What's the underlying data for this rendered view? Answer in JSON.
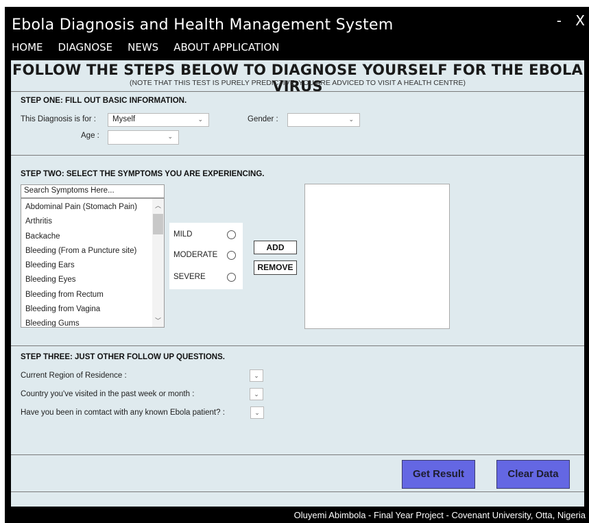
{
  "window": {
    "title": "Ebola Diagnosis and Health Management System",
    "minimize": "-",
    "close": "X"
  },
  "menu": [
    "HOME",
    "DIAGNOSE",
    "NEWS",
    "ABOUT APPLICATION"
  ],
  "main": {
    "heading": "FOLLOW THE STEPS BELOW TO DIAGNOSE YOURSELF FOR THE EBOLA VIRUS",
    "subheading": "(NOTE THAT THIS TEST IS PURELY PREDICTIVE, YOU ARE ADVICED TO VISIT A HEALTH CENTRE)"
  },
  "step1": {
    "heading": "STEP ONE: FILL OUT BASIC INFORMATION.",
    "diagnosis_for_label": "This Diagnosis is for :",
    "diagnosis_for_value": "Myself",
    "gender_label": "Gender :",
    "gender_value": "",
    "age_label": "Age :",
    "age_value": ""
  },
  "step2": {
    "heading": "STEP TWO: SELECT THE SYMPTOMS YOU ARE EXPERIENCING.",
    "search_placeholder": "Search Symptoms Here...",
    "symptoms": [
      "Abdominal Pain (Stomach Pain)",
      "Arthritis",
      "Backache",
      "Bleeding (From a Puncture site)",
      "Bleeding Ears",
      "Bleeding Eyes",
      "Bleeding from Rectum",
      "Bleeding from Vagina",
      "Bleeding Gums"
    ],
    "severity": [
      "MILD",
      "MODERATE",
      "SEVERE"
    ],
    "add_label": "ADD",
    "remove_label": "REMOVE"
  },
  "step3": {
    "heading": "STEP THREE: JUST OTHER FOLLOW UP QUESTIONS.",
    "q_region": "Current Region of Residence :",
    "q_country": "Country you've visited in the past week or month :",
    "q_contact": "Have you been in comtact with any known Ebola patient? :"
  },
  "actions": {
    "get_result": "Get Result",
    "clear_data": "Clear Data"
  },
  "footer": "Oluyemi Abimbola - Final Year Project - Covenant University, Otta, Nigeria",
  "icons": {
    "dropdown": "chevron-down-icon",
    "scroll_up": "chevron-up-icon"
  },
  "colors": {
    "accent_button": "#6467e3",
    "panel_background": "#dfeaee",
    "chrome": "#000000"
  }
}
